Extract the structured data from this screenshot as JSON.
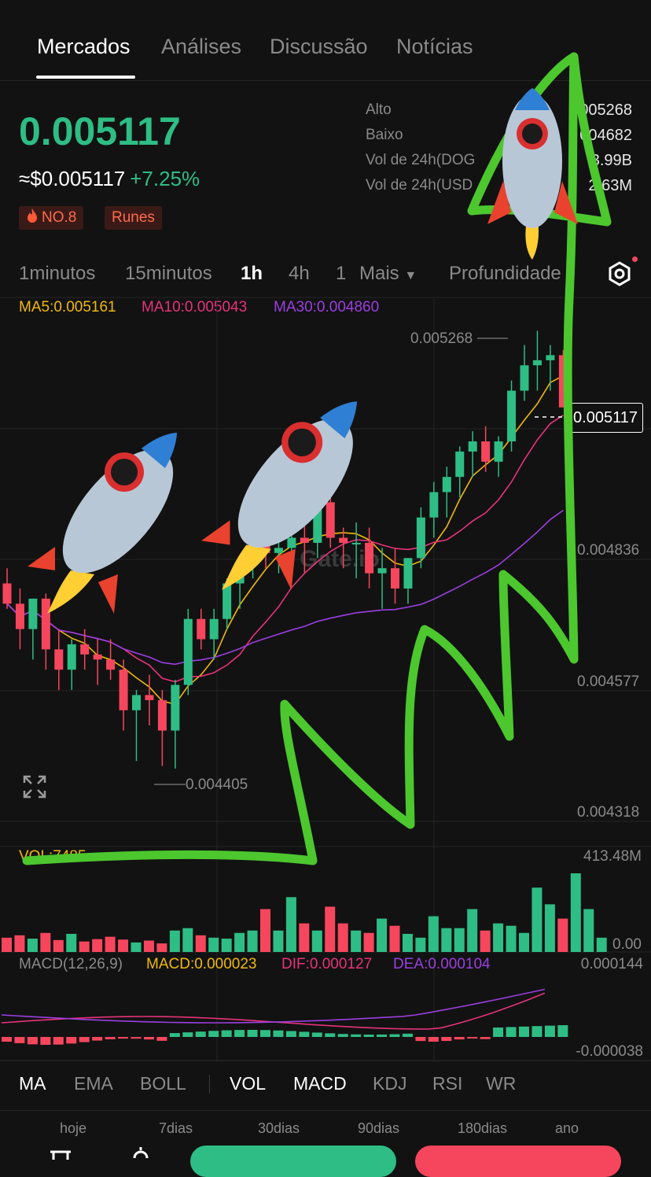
{
  "tabs": [
    {
      "label": "Mercados",
      "active": true
    },
    {
      "label": "Análises",
      "active": false
    },
    {
      "label": "Discussão",
      "active": false
    },
    {
      "label": "Notícias",
      "active": false
    }
  ],
  "ticker": {
    "price": "0.005117",
    "usd_price": "≈$0.005117",
    "change": "+7.25%",
    "tags": [
      "NO.8",
      "Runes"
    ],
    "stats": [
      {
        "label": "Alto",
        "value": "005268"
      },
      {
        "label": "Baixo",
        "value": "004682"
      },
      {
        "label": "Vol de 24h(DOG",
        "value": "3.99B"
      },
      {
        "label": "Vol de 24h(USD",
        "value": "2.63M"
      }
    ]
  },
  "intervals": {
    "items": [
      "1minutos",
      "15minutos",
      "1h",
      "4h",
      "1",
      "Mais"
    ],
    "active": "1h",
    "depth": "Profundidade"
  },
  "ma_legend": {
    "ma5": "MA5:0.005161",
    "ma10": "MA10:0.005043",
    "ma30": "MA30:0.004860"
  },
  "colors": {
    "up": "#2ebd85",
    "down": "#f6465d",
    "ma5": "#f0b90b",
    "ma10": "#e6337a",
    "ma30": "#9b3fe0",
    "annotation": "#4cc72e"
  },
  "chart_data": {
    "type": "candlestick",
    "price_axis": [
      "0.004836",
      "0.004577",
      "0.004318"
    ],
    "high_marker": "0.005268",
    "low_marker": "0.004405",
    "current_price_label": "0.005117",
    "watermark": "Gate.io",
    "volume_axis": [
      "413.48M",
      "0.00"
    ],
    "volume_legend": "VOL:7485.....",
    "macd_legend": {
      "name": "MACD(12,26,9)",
      "macd": "MACD:0.000023",
      "dif": "DIF:0.000127",
      "dea": "DEA:0.000104"
    },
    "macd_axis": [
      "0.000144",
      "-0.000038"
    ],
    "candles": [
      {
        "o": 0.00477,
        "h": 0.0048,
        "l": 0.00472,
        "c": 0.00473
      },
      {
        "o": 0.00473,
        "h": 0.00476,
        "l": 0.00464,
        "c": 0.00468
      },
      {
        "o": 0.00468,
        "h": 0.00474,
        "l": 0.00462,
        "c": 0.00474
      },
      {
        "o": 0.00474,
        "h": 0.00475,
        "l": 0.0046,
        "c": 0.00464
      },
      {
        "o": 0.00464,
        "h": 0.00468,
        "l": 0.00456,
        "c": 0.0046
      },
      {
        "o": 0.0046,
        "h": 0.00466,
        "l": 0.00456,
        "c": 0.00465
      },
      {
        "o": 0.00465,
        "h": 0.00468,
        "l": 0.0046,
        "c": 0.00463
      },
      {
        "o": 0.00463,
        "h": 0.00466,
        "l": 0.00457,
        "c": 0.00462
      },
      {
        "o": 0.00462,
        "h": 0.00466,
        "l": 0.00458,
        "c": 0.0046
      },
      {
        "o": 0.0046,
        "h": 0.00462,
        "l": 0.00448,
        "c": 0.00452
      },
      {
        "o": 0.00452,
        "h": 0.00456,
        "l": 0.00442,
        "c": 0.00455
      },
      {
        "o": 0.00455,
        "h": 0.00459,
        "l": 0.00449,
        "c": 0.00454
      },
      {
        "o": 0.00454,
        "h": 0.00456,
        "l": 0.00441,
        "c": 0.00448
      },
      {
        "o": 0.00448,
        "h": 0.00458,
        "l": 0.004405,
        "c": 0.00457
      },
      {
        "o": 0.00457,
        "h": 0.00472,
        "l": 0.00455,
        "c": 0.0047
      },
      {
        "o": 0.0047,
        "h": 0.00472,
        "l": 0.00464,
        "c": 0.00466
      },
      {
        "o": 0.00466,
        "h": 0.00472,
        "l": 0.00462,
        "c": 0.0047
      },
      {
        "o": 0.0047,
        "h": 0.00478,
        "l": 0.00468,
        "c": 0.00477
      },
      {
        "o": 0.00477,
        "h": 0.00482,
        "l": 0.00472,
        "c": 0.00481
      },
      {
        "o": 0.00481,
        "h": 0.0049,
        "l": 0.00478,
        "c": 0.00488
      },
      {
        "o": 0.00488,
        "h": 0.0049,
        "l": 0.0048,
        "c": 0.00483
      },
      {
        "o": 0.00483,
        "h": 0.00487,
        "l": 0.00479,
        "c": 0.00484
      },
      {
        "o": 0.00484,
        "h": 0.00488,
        "l": 0.00481,
        "c": 0.00486
      },
      {
        "o": 0.00486,
        "h": 0.00491,
        "l": 0.00479,
        "c": 0.00485
      },
      {
        "o": 0.00485,
        "h": 0.00495,
        "l": 0.00482,
        "c": 0.00493
      },
      {
        "o": 0.00493,
        "h": 0.00495,
        "l": 0.00484,
        "c": 0.00486
      },
      {
        "o": 0.00486,
        "h": 0.00488,
        "l": 0.0048,
        "c": 0.00485
      },
      {
        "o": 0.00485,
        "h": 0.00489,
        "l": 0.00478,
        "c": 0.00485
      },
      {
        "o": 0.00485,
        "h": 0.00488,
        "l": 0.00476,
        "c": 0.00479
      },
      {
        "o": 0.00479,
        "h": 0.00484,
        "l": 0.00472,
        "c": 0.0048
      },
      {
        "o": 0.0048,
        "h": 0.00484,
        "l": 0.00473,
        "c": 0.00476
      },
      {
        "o": 0.00476,
        "h": 0.00482,
        "l": 0.00473,
        "c": 0.00482
      },
      {
        "o": 0.00482,
        "h": 0.00492,
        "l": 0.0048,
        "c": 0.0049
      },
      {
        "o": 0.0049,
        "h": 0.00497,
        "l": 0.00486,
        "c": 0.00495
      },
      {
        "o": 0.00495,
        "h": 0.005,
        "l": 0.0049,
        "c": 0.00498
      },
      {
        "o": 0.00498,
        "h": 0.00504,
        "l": 0.00494,
        "c": 0.00503
      },
      {
        "o": 0.00503,
        "h": 0.00507,
        "l": 0.00498,
        "c": 0.00505
      },
      {
        "o": 0.00505,
        "h": 0.00508,
        "l": 0.00499,
        "c": 0.00501
      },
      {
        "o": 0.00501,
        "h": 0.00506,
        "l": 0.00498,
        "c": 0.00505
      },
      {
        "o": 0.00505,
        "h": 0.00517,
        "l": 0.00503,
        "c": 0.00515
      },
      {
        "o": 0.00515,
        "h": 0.00524,
        "l": 0.00513,
        "c": 0.0052
      },
      {
        "o": 0.0052,
        "h": 0.005268,
        "l": 0.00515,
        "c": 0.00521
      },
      {
        "o": 0.00521,
        "h": 0.00524,
        "l": 0.00515,
        "c": 0.00522
      },
      {
        "o": 0.00522,
        "h": 0.00523,
        "l": 0.00512,
        "c": 0.005117
      }
    ],
    "volumes": [
      30,
      35,
      28,
      40,
      25,
      38,
      22,
      27,
      32,
      26,
      20,
      24,
      18,
      45,
      50,
      35,
      30,
      28,
      40,
      45,
      90,
      45,
      115,
      60,
      45,
      95,
      60,
      45,
      40,
      70,
      55,
      38,
      30,
      75,
      50,
      50,
      90,
      45,
      60,
      55,
      40,
      135,
      100,
      70,
      165,
      90,
      30
    ]
  },
  "indicator_tabs": [
    "MA",
    "EMA",
    "BOLL",
    "VOL",
    "MACD",
    "KDJ",
    "RSI",
    "WR"
  ],
  "periods": [
    "hoje",
    "7dias",
    "30dias",
    "90dias",
    "180dias",
    "ano"
  ]
}
